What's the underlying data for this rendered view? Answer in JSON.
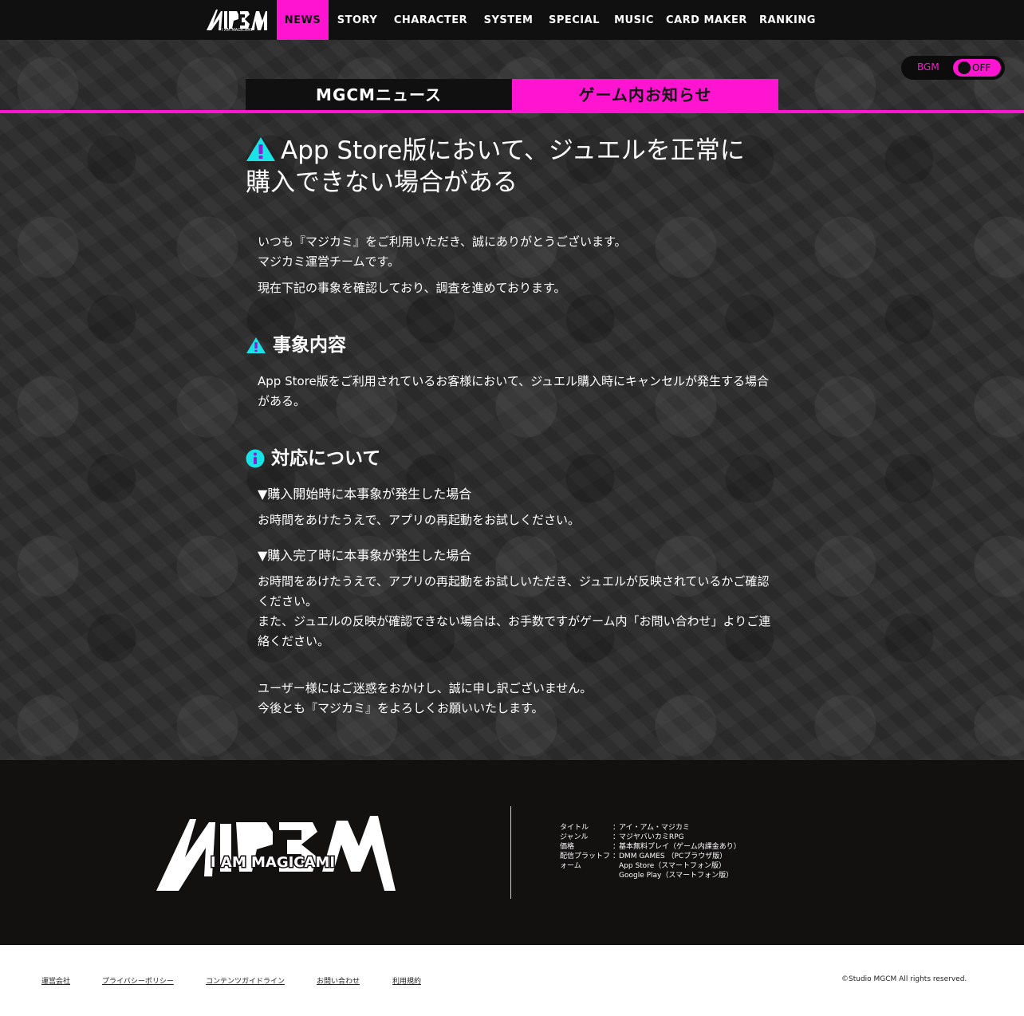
{
  "nav": {
    "logo_text": "I AM MAGICAMI",
    "items": [
      "NEWS",
      "STORY",
      "CHARACTER",
      "SYSTEM",
      "SPECIAL",
      "MUSIC",
      "CARD MAKER",
      "RANKING"
    ]
  },
  "bgm": {
    "label": "BGM",
    "state": "OFF"
  },
  "tabs": {
    "news": "MGCMニュース",
    "info": "ゲーム内お知らせ"
  },
  "article": {
    "title_line1": "App Store版において、ジュエルを正常に",
    "title_line2": "購入できない場合がある",
    "intro1": "いつも『マジカミ』をご利用いただき、誠にありがとうございます。",
    "intro2": "マジカミ運営チームです。",
    "intro3": "現在下記の事象を確認しており、調査を進めております。",
    "section1_heading": "事象内容",
    "section1_body": "App Store版をご利用されているお客様において、ジュエル購入時にキャンセルが発生する場合がある。",
    "section2_heading": "対応について",
    "case1_heading": "▼購入開始時に本事象が発生した場合",
    "case1_body": "お時間をあけたうえで、アプリの再起動をお試しください。",
    "case2_heading": "▼購入完了時に本事象が発生した場合",
    "case2_body1": "お時間をあけたうえで、アプリの再起動をお試しいただき、ジュエルが反映されているかご確認ください。",
    "case2_body2": "また、ジュエルの反映が確認できない場合は、お手数ですがゲーム内「お問い合わせ」よりご連絡ください。",
    "closing1": "ユーザー様にはご迷惑をおかけし、誠に申し訳ございません。",
    "closing2": "今後とも『マジカミ』をよろしくお願いいたします。"
  },
  "footer": {
    "logo_text": "I AM MAGICAMI",
    "info": {
      "title_key": "タイトル",
      "title_val": "アイ・アム・マジカミ",
      "genre_key": "ジャンル",
      "genre_val": "マジヤバいカミRPG",
      "price_key": "価格",
      "price_val": "基本無料プレイ（ゲーム内課金あり）",
      "platform_key": "配信プラットフォーム",
      "platform_val1": "DMM GAMES （PCブラウザ版）",
      "platform_val2": "App Store（スマートフォン版）",
      "platform_val3": "Google Play（スマートフォン版）"
    },
    "links": [
      "運営会社",
      "プライバシーポリシー",
      "コンテンツガイドライン",
      "お問い合わせ",
      "利用規約"
    ],
    "copyright": "©Studio MGCM All rights reserved."
  },
  "colors": {
    "accent": "#ff14d2",
    "nav_bg": "#111010",
    "footer_bg": "#121110"
  }
}
